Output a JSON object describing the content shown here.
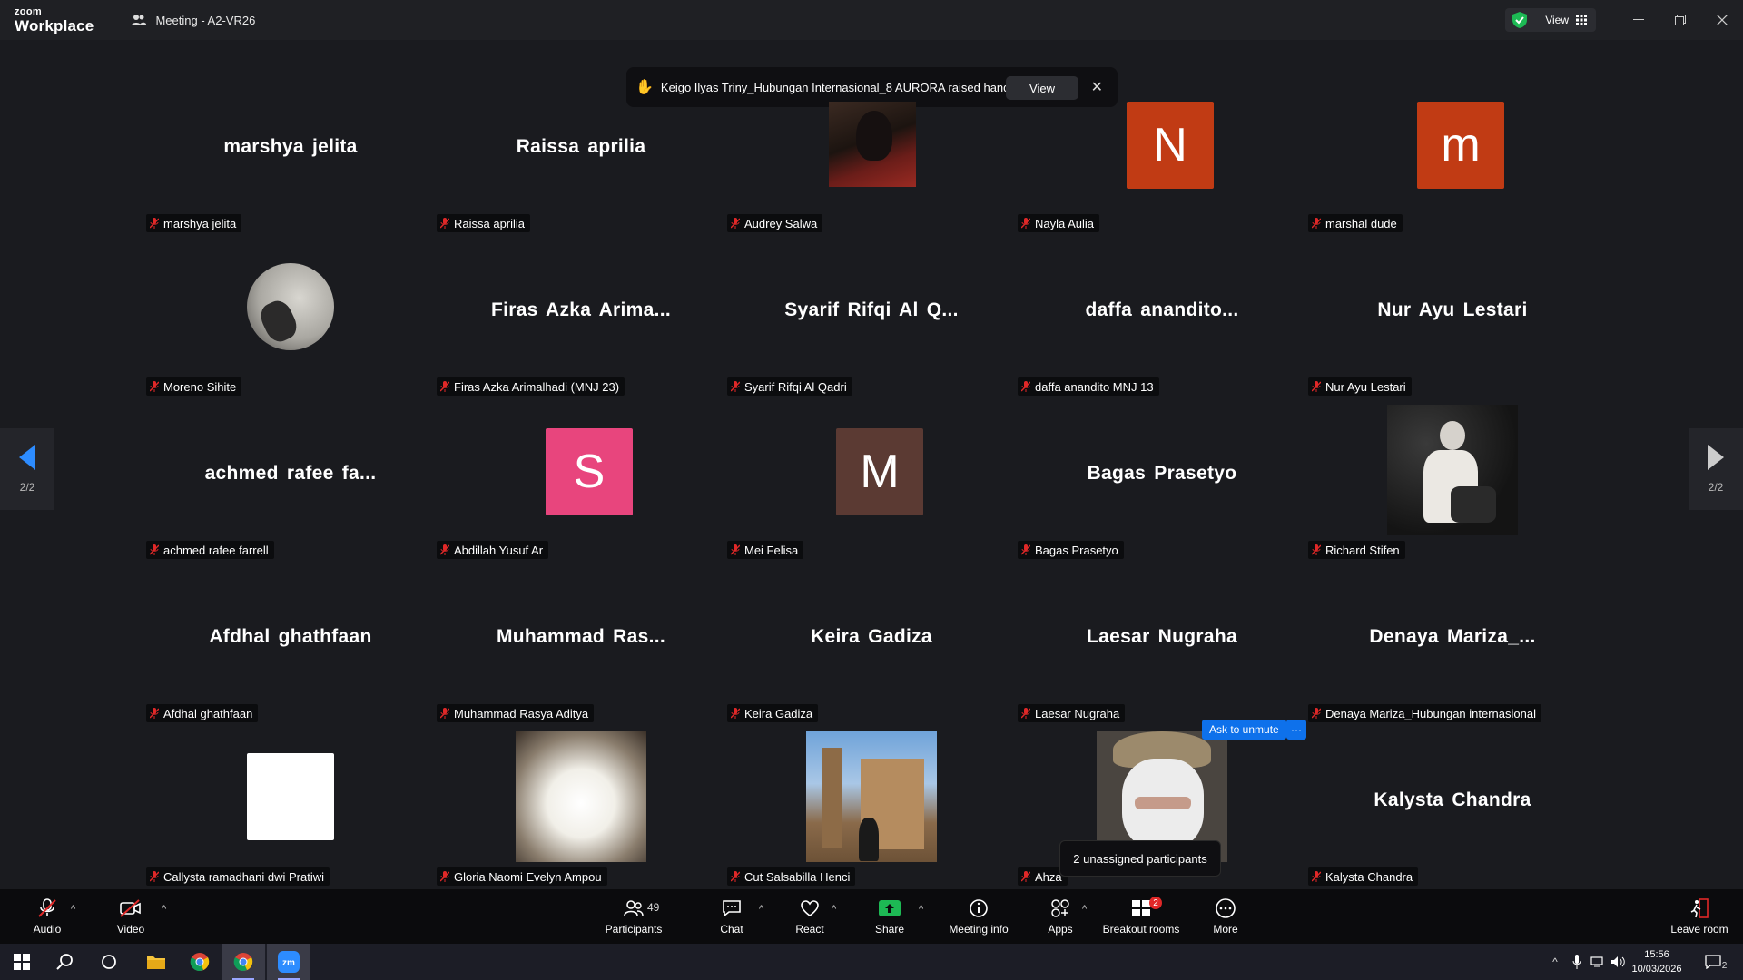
{
  "app": {
    "brand_top": "zoom",
    "brand_bottom": "Workplace",
    "meeting_title": "Meeting - A2-VR26"
  },
  "titlebar": {
    "view_label": "View"
  },
  "notification": {
    "text": "Keigo Ilyas Triny_Hubungan Internasional_8 AURORA raised hand",
    "view_button": "View"
  },
  "tiles": [
    {
      "big_name": "marshya jelita",
      "label": "marshya jelita"
    },
    {
      "big_name": "Raissa aprilia",
      "label": "Raissa aprilia"
    },
    {
      "label": "Audrey Salwa"
    },
    {
      "avatar_letter": "N",
      "label": "Nayla Aulia"
    },
    {
      "avatar_letter": "m",
      "label": "marshal dude"
    },
    {
      "label": "Moreno Sihite"
    },
    {
      "big_name": "Firas Azka Arima...",
      "label": "Firas Azka Arimalhadi (MNJ 23)"
    },
    {
      "big_name": "Syarif Rifqi Al Q...",
      "label": "Syarif Rifqi Al Qadri"
    },
    {
      "big_name": "daffa anandito...",
      "label": "daffa anandito MNJ 13"
    },
    {
      "big_name": "Nur Ayu Lestari",
      "label": "Nur Ayu Lestari"
    },
    {
      "big_name": "achmed rafee fa...",
      "label": "achmed rafee farrell"
    },
    {
      "avatar_letter": "S",
      "label": "Abdillah Yusuf Ar"
    },
    {
      "avatar_letter": "M",
      "label": "Mei Felisa"
    },
    {
      "big_name": "Bagas Prasetyo",
      "label": "Bagas Prasetyo"
    },
    {
      "label": "Richard Stifen"
    },
    {
      "big_name": "Afdhal ghathfaan",
      "label": "Afdhal ghathfaan"
    },
    {
      "big_name": "Muhammad Ras...",
      "label": "Muhammad Rasya Aditya"
    },
    {
      "big_name": "Keira Gadiza",
      "label": "Keira Gadiza"
    },
    {
      "big_name": "Laesar Nugraha",
      "label": "Laesar Nugraha"
    },
    {
      "big_name": "Denaya Mariza_...",
      "label": "Denaya Mariza_Hubungan internasional"
    },
    {
      "label": "Callysta ramadhani dwi Pratiwi"
    },
    {
      "label": "Gloria Naomi Evelyn Ampou"
    },
    {
      "label": "Cut Salsabilla Henci"
    },
    {
      "label": "Ahza"
    },
    {
      "big_name": "Kalysta Chandra",
      "label": "Kalysta Chandra"
    }
  ],
  "colors": {
    "avatar_N": "#c13b14",
    "avatar_m": "#c13b14",
    "avatar_S": "#e8457d",
    "avatar_M": "#5b3a33",
    "accent": "#0e71eb"
  },
  "pager": {
    "left": "2/2",
    "right": "2/2"
  },
  "ask_unmute": {
    "label": "Ask to unmute",
    "more": "···"
  },
  "tooltip": {
    "text": "2 unassigned participants"
  },
  "toolbar": {
    "audio": "Audio",
    "video": "Video",
    "participants": "Participants",
    "participant_count": "49",
    "chat": "Chat",
    "react": "React",
    "share": "Share",
    "meeting_info": "Meeting info",
    "apps": "Apps",
    "breakout": "Breakout rooms",
    "breakout_badge": "2",
    "more": "More",
    "leave": "Leave room"
  },
  "taskbar": {
    "time": "15:56",
    "date": "10/03/2026",
    "notification_count": "2"
  }
}
